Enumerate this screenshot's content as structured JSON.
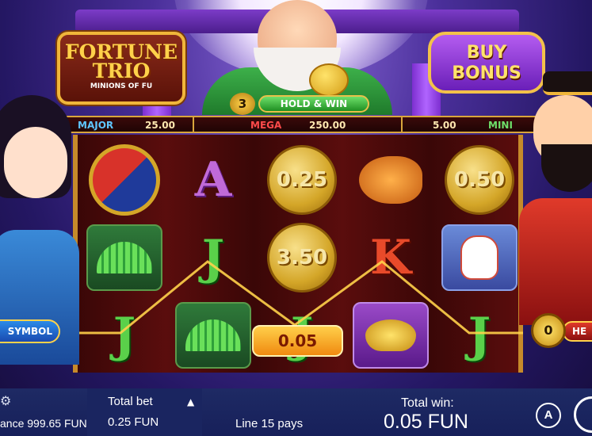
{
  "logo": {
    "line1": "FORTUNE",
    "line2": "TRIO",
    "line3": "MINIONS OF FU"
  },
  "buy_bonus": {
    "line1": "BUY",
    "line2": "BONUS"
  },
  "hold_win": {
    "count": "3",
    "label": "HOLD & WIN"
  },
  "jackpots": {
    "major_label": "MAJOR",
    "major_value": "25.00",
    "mega_label": "MEGA",
    "mega_value": "250.00",
    "mini_value": "5.00",
    "mini_label": "MINI"
  },
  "reels": {
    "r1": [
      "yin-yang",
      "fan",
      "J"
    ],
    "r2": [
      "A",
      "J",
      "fan"
    ],
    "r3": [
      "0.25",
      "3.50",
      "J"
    ],
    "r4": [
      "koi-fish",
      "K",
      "gold-ingot"
    ],
    "r5": [
      "0.50",
      "lucky-cat",
      "J"
    ]
  },
  "coin_values": {
    "c1": "0.25",
    "c2": "3.50",
    "c3": "0.50"
  },
  "win_badge": "0.05",
  "left_button": "SYMBOL",
  "right_button": {
    "count": "0",
    "label": "HE"
  },
  "footer": {
    "balance": "ance 999.65 FUN",
    "total_bet_label": "Total bet",
    "total_bet_value": "0.25 FUN",
    "line_pays": "Line 15 pays",
    "total_win_label": "Total win:",
    "total_win_value": "0.05 FUN",
    "auto_label": "A"
  },
  "colors": {
    "gold": "#f0b63a",
    "win": "#ffcf4a",
    "major": "#5fc6ff",
    "mega": "#ff4a4a",
    "mini": "#6ee06a"
  }
}
